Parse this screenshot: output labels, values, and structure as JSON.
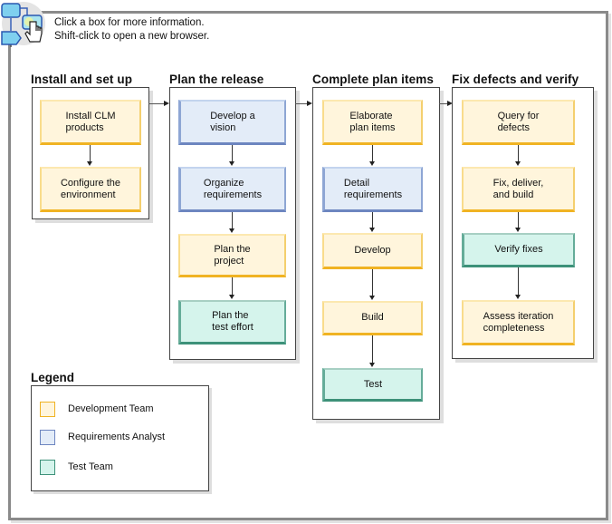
{
  "header": {
    "icon": "clickable-flowchart-hand-icon",
    "line1": "Click a box for more information.",
    "line2": "Shift-click to open a new browser."
  },
  "stages": [
    {
      "title": "Install and set up",
      "tasks": [
        {
          "label": "Install CLM\nproducts",
          "role": "Development Team"
        },
        {
          "label": "Configure the\nenvironment",
          "role": "Development Team"
        }
      ]
    },
    {
      "title": "Plan the release",
      "tasks": [
        {
          "label": "Develop a\nvision",
          "role": "Requirements Analyst"
        },
        {
          "label": "Organize\nrequirements",
          "role": "Requirements Analyst"
        },
        {
          "label": "Plan the\nproject",
          "role": "Development Team"
        },
        {
          "label": "Plan the\ntest effort",
          "role": "Test Team"
        }
      ]
    },
    {
      "title": "Complete plan items",
      "tasks": [
        {
          "label": "Elaborate\nplan items",
          "role": "Development Team"
        },
        {
          "label": "Detail\nrequirements",
          "role": "Requirements Analyst"
        },
        {
          "label": "Develop",
          "role": "Development Team"
        },
        {
          "label": "Build",
          "role": "Development Team"
        },
        {
          "label": "Test",
          "role": "Test Team"
        }
      ]
    },
    {
      "title": "Fix defects and verify",
      "tasks": [
        {
          "label": "Query for\ndefects",
          "role": "Development Team"
        },
        {
          "label": "Fix, deliver,\nand build",
          "role": "Development Team"
        },
        {
          "label": "Verify fixes",
          "role": "Test Team"
        },
        {
          "label": "Assess iteration\ncompleteness",
          "role": "Development Team"
        }
      ]
    }
  ],
  "legend": {
    "title": "Legend",
    "items": [
      {
        "label": "Development Team",
        "color": "#f0b323",
        "fill": "#fff5dc"
      },
      {
        "label": "Requirements Analyst",
        "color": "#6d86c0",
        "fill": "#e3ecf8"
      },
      {
        "label": "Test Team",
        "color": "#3d9179",
        "fill": "#d5f4ec"
      }
    ]
  },
  "colors": {
    "frame": "#8a8a8a",
    "dev_team": "#f0b323",
    "requirements_analyst": "#6d86c0",
    "test_team": "#3d9179"
  }
}
